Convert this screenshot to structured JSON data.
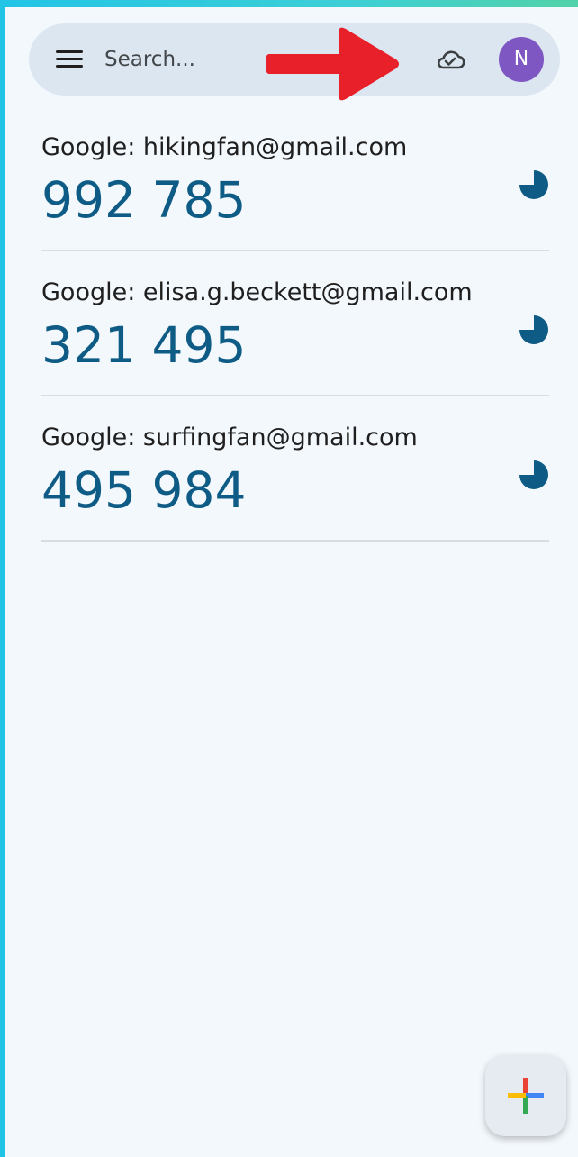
{
  "search": {
    "placeholder": "Search..."
  },
  "profile": {
    "initial": "N",
    "color": "#7e57c2"
  },
  "accounts": [
    {
      "label": "Google: hikingfan@gmail.com",
      "code": "992 785"
    },
    {
      "label": "Google: elisa.g.beckett@gmail.com",
      "code": "321 495"
    },
    {
      "label": "Google: surfingfan@gmail.com",
      "code": "495 984"
    }
  ],
  "icons": {
    "menu": "menu-icon",
    "cloud": "cloud-check-icon",
    "timer": "countdown-timer-icon",
    "add": "plus-icon",
    "annotation": "red-arrow-annotation"
  },
  "colors": {
    "code": "#0e5c85",
    "timer": "#0e5c85",
    "annotation_arrow": "#e8202a"
  }
}
